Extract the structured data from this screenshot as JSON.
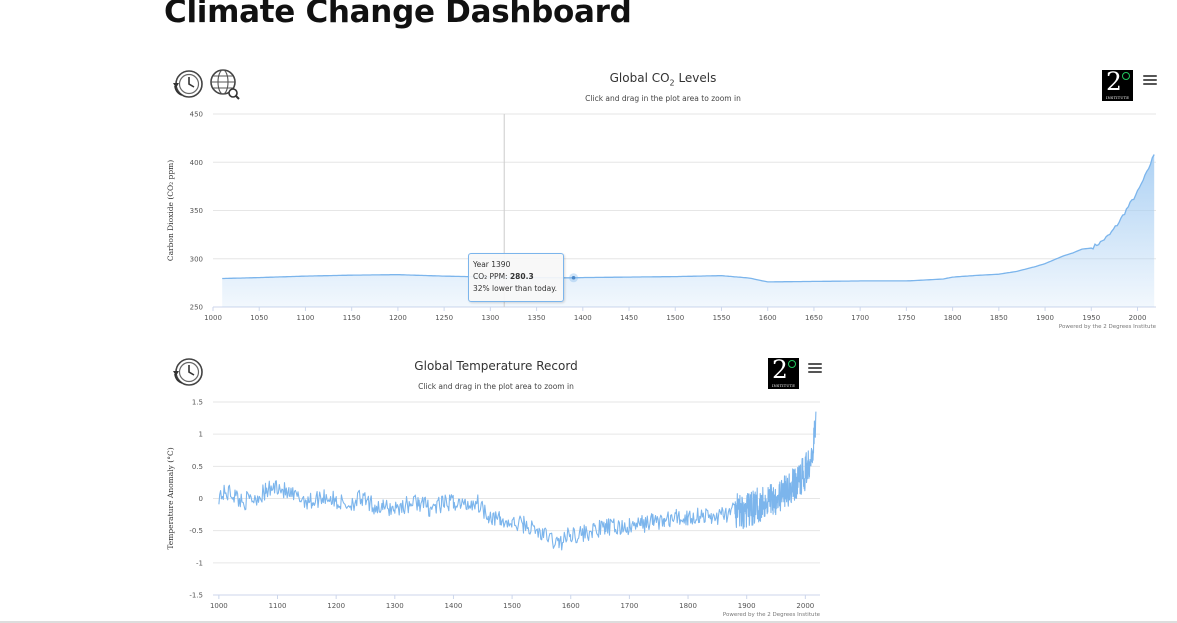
{
  "page": {
    "title": "Climate Change Dashboard"
  },
  "colors": {
    "series": "#7cb5ec",
    "area_top": "#a9cff3",
    "grid": "#e6e6e6",
    "text": "#333333",
    "logo_accent": "#22c55e"
  },
  "chart_data": [
    {
      "id": "co2",
      "type": "area",
      "title_main": "Global CO",
      "title_sub": "2",
      "title_tail": " Levels",
      "subtitle": "Click and drag in the plot area to zoom in",
      "ylabel": "Carbon Dioxide (CO₂ ppm)",
      "xlabel": "",
      "xlim": [
        1000,
        2020
      ],
      "ylim": [
        250,
        450
      ],
      "grid": true,
      "x_ticks": [
        1000,
        1050,
        1100,
        1150,
        1200,
        1250,
        1300,
        1350,
        1400,
        1450,
        1500,
        1550,
        1600,
        1650,
        1700,
        1750,
        1800,
        1850,
        1900,
        1950,
        2000
      ],
      "y_ticks": [
        250,
        300,
        350,
        400,
        450
      ],
      "credits": "Powered by the 2 Degrees Institute",
      "series": [
        {
          "x": [
            1010,
            1050,
            1100,
            1150,
            1200,
            1250,
            1300,
            1350,
            1390,
            1400,
            1450,
            1500,
            1550,
            1580,
            1600,
            1650,
            1700,
            1750,
            1790,
            1800,
            1830,
            1850,
            1870,
            1890,
            1900,
            1910,
            1920,
            1930,
            1940,
            1950,
            1960,
            1970,
            1980,
            1990,
            2000,
            2010,
            2018
          ],
          "y": [
            279.5,
            280.5,
            282,
            283,
            283.5,
            282,
            281,
            280.5,
            280.2,
            280.5,
            281,
            281.5,
            282.5,
            280,
            276,
            276.5,
            277,
            277,
            279,
            281,
            283,
            284,
            287,
            292,
            295,
            299,
            303,
            306,
            310,
            311,
            317,
            325,
            338,
            354,
            369,
            389,
            408
          ]
        }
      ],
      "crosshair_x": 1315,
      "tooltip": {
        "year_label": "Year 1390",
        "ppm_label": "CO₂ PPM:",
        "ppm_value": "280.3",
        "note": "32% lower than today."
      }
    },
    {
      "id": "temp",
      "type": "line",
      "title": "Global Temperature Record",
      "subtitle": "Click and drag in the plot area to zoom in",
      "ylabel": "Temperature Anomaly (°C)",
      "xlabel": "",
      "xlim": [
        990,
        2025
      ],
      "ylim": [
        -1.5,
        1.5
      ],
      "grid": true,
      "x_ticks": [
        1000,
        1100,
        1200,
        1300,
        1400,
        1500,
        1600,
        1700,
        1800,
        1900,
        2000
      ],
      "y_ticks": [
        -1.5,
        -1,
        -0.5,
        0,
        0.5,
        1,
        1.5
      ],
      "y_tick_labels": [
        "-1.5",
        "-1",
        "-0.5",
        "0",
        "0.5",
        "1",
        "1.5"
      ],
      "credits": "Powered by the 2 Degrees Institute",
      "series": [
        {
          "x": [
            1000,
            1020,
            1040,
            1060,
            1080,
            1100,
            1120,
            1140,
            1160,
            1180,
            1200,
            1220,
            1240,
            1260,
            1280,
            1300,
            1320,
            1340,
            1360,
            1380,
            1400,
            1420,
            1440,
            1460,
            1480,
            1500,
            1520,
            1540,
            1560,
            1580,
            1600,
            1620,
            1640,
            1660,
            1680,
            1700,
            1720,
            1740,
            1760,
            1780,
            1800,
            1820,
            1840,
            1860,
            1880,
            1900,
            1920,
            1940,
            1960,
            1980,
            2000,
            2010,
            2018
          ],
          "y": [
            0.05,
            0.1,
            -0.05,
            0.0,
            0.1,
            0.2,
            0.05,
            0.0,
            -0.05,
            0.05,
            -0.05,
            -0.1,
            0.0,
            -0.1,
            -0.15,
            -0.15,
            -0.1,
            -0.05,
            -0.15,
            -0.1,
            -0.05,
            -0.1,
            -0.05,
            -0.25,
            -0.35,
            -0.4,
            -0.4,
            -0.5,
            -0.6,
            -0.7,
            -0.55,
            -0.55,
            -0.5,
            -0.45,
            -0.45,
            -0.45,
            -0.4,
            -0.35,
            -0.35,
            -0.3,
            -0.3,
            -0.25,
            -0.3,
            -0.25,
            -0.2,
            -0.2,
            -0.1,
            0.0,
            0.05,
            0.2,
            0.4,
            0.7,
            1.1
          ]
        }
      ]
    }
  ]
}
